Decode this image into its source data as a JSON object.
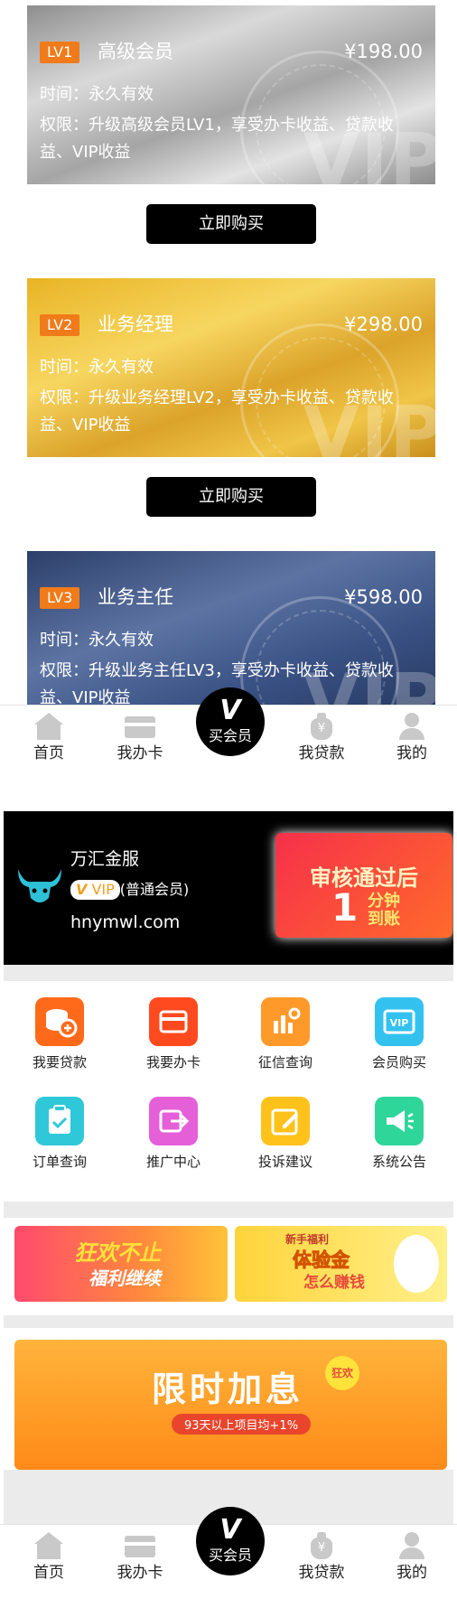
{
  "cards": [
    {
      "lv": "LV1",
      "name": "高级会员",
      "price": "¥198.00",
      "time": "时间：永久有效",
      "perm": "权限：升级高级会员LV1，享受办卡收益、贷款收益、VIP收益",
      "wm": "VIP"
    },
    {
      "lv": "LV2",
      "name": "业务经理",
      "price": "¥298.00",
      "time": "时间：永久有效",
      "perm": "权限：升级业务经理LV2，享受办卡收益、贷款收益、VIP收益",
      "wm": "VIP"
    },
    {
      "lv": "LV3",
      "name": "业务主任",
      "price": "¥598.00",
      "time": "时间：永久有效",
      "perm": "权限：升级业务主任LV3，享受办卡收益、贷款收益、VIP收益",
      "wm": "VIP"
    }
  ],
  "buy_label": "立即购买",
  "tabbar": {
    "home": "首页",
    "card": "我办卡",
    "center_v": "V",
    "center_label": "买会员",
    "loan": "我贷款",
    "mine": "我的",
    "loan_icon_glyph": "¥"
  },
  "profile": {
    "name": "万汇金服",
    "vip_badge": "VIP",
    "level": "(普通会员)",
    "domain": "hnymwl.com",
    "banner_line1": "审核通过后",
    "banner_num": "1",
    "banner_unit": "分钟到账"
  },
  "grid": [
    {
      "label": "我要贷款",
      "color": "#ff6a1a",
      "icon": "coin-stack-icon"
    },
    {
      "label": "我要办卡",
      "color": "#ff4a1f",
      "icon": "credit-card-icon"
    },
    {
      "label": "征信查询",
      "color": "#ff9a2a",
      "icon": "credit-report-icon"
    },
    {
      "label": "会员购买",
      "color": "#33c2f0",
      "icon": "vip-icon"
    },
    {
      "label": "订单查询",
      "color": "#2ec8d8",
      "icon": "order-clipboard-icon"
    },
    {
      "label": "推广中心",
      "color": "#e45fd8",
      "icon": "share-icon"
    },
    {
      "label": "投诉建议",
      "color": "#ffc21a",
      "icon": "edit-icon"
    },
    {
      "label": "系统公告",
      "color": "#2ed69a",
      "icon": "megaphone-icon"
    }
  ],
  "promos": {
    "p1_title": "狂欢不止",
    "p1_sub": "福利继续",
    "p2_tag": "新手福利",
    "p2_title": "体验金",
    "p2_sub": "怎么赚钱",
    "p3_title": "限时加息",
    "p3_badge": "狂欢",
    "p3_note": "93天以上项目均+1%"
  }
}
